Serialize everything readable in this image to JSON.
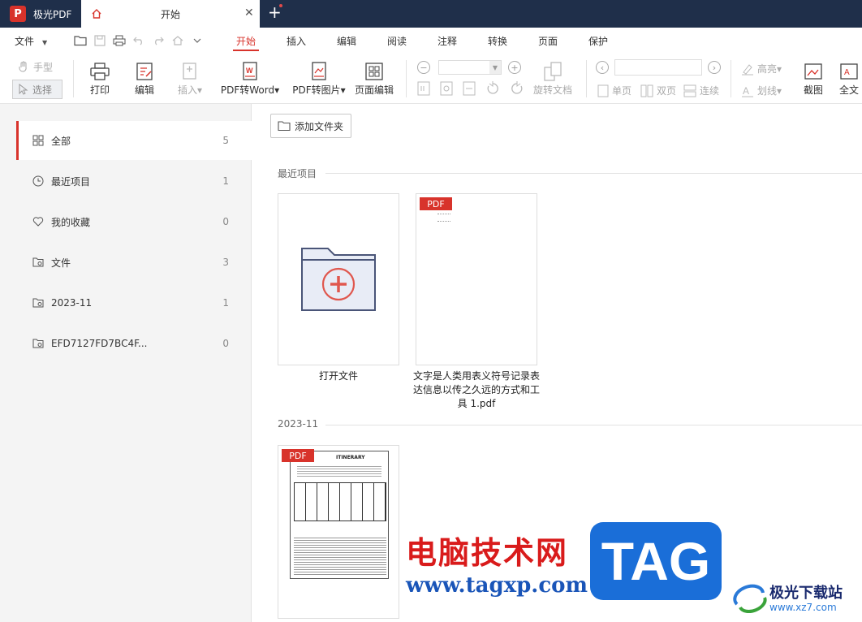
{
  "titlebar": {
    "app_name": "极光PDF",
    "app_logo_letter": "P",
    "doc_tab_title": "开始",
    "new_tab": "+"
  },
  "menubar": {
    "file": "文件",
    "tabs": [
      "开始",
      "插入",
      "编辑",
      "阅读",
      "注释",
      "转换",
      "页面",
      "保护"
    ],
    "active_tab": "开始"
  },
  "ribbon": {
    "hand": "手型",
    "select": "选择",
    "print": "打印",
    "edit": "编辑",
    "insert": "插入",
    "pdf_to_word": "PDF转Word",
    "pdf_to_image": "PDF转图片",
    "page_edit": "页面编辑",
    "rotate_doc": "旋转文档",
    "single_page": "单页",
    "double_page": "双页",
    "continuous": "连续",
    "highlight": "高亮",
    "strikethrough": "划线",
    "screenshot": "截图",
    "full_text": "全文"
  },
  "sidebar": {
    "items": [
      {
        "label": "全部",
        "count": "5"
      },
      {
        "label": "最近项目",
        "count": "1"
      },
      {
        "label": "我的收藏",
        "count": "0"
      },
      {
        "label": "文件",
        "count": "3"
      },
      {
        "label": "2023-11",
        "count": "1"
      },
      {
        "label": "EFD7127FD7BC4F...",
        "count": "0"
      }
    ]
  },
  "main": {
    "add_folder": "添加文件夹",
    "recent_title": "最近项目",
    "open_file": "打开文件",
    "pdf_badge": "PDF",
    "recent_file_name": "文字是人类用表义符号记录表达信息以传之久远的方式和工具 1.pdf",
    "month_title": "2023-11",
    "itinerary_heading": "ITINERARY"
  },
  "watermark": {
    "cn_text": "电脑技术网",
    "url": "www.tagxp.com",
    "tag": "TAG",
    "site_name": "极光下载站",
    "site_url": "www.xz7.com"
  },
  "colors": {
    "accent": "#d8332b",
    "titlebar": "#1f2f4a",
    "sidebar_bg": "#f4f4f4",
    "folder_fill": "#e8ecf6",
    "folder_stroke": "#4a5578"
  }
}
